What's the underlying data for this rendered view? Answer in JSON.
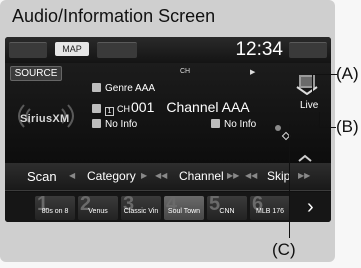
{
  "frame_title": "Audio/Information Screen",
  "header": {
    "map_label": "MAP",
    "clock": "12:34"
  },
  "info": {
    "source_label": "SOURCE",
    "brand": "SiriusXM",
    "ch_label": "CH",
    "genre": "Genre AAA",
    "preset_digit": "1",
    "ch_prefix": "CH",
    "channel_number": "001",
    "channel_name": "Channel AAA",
    "left_info": "No Info",
    "right_info": "No Info",
    "live_label": "Live"
  },
  "nav": {
    "scan": "Scan",
    "category": "Category",
    "channel": "Channel",
    "skip": "Skip"
  },
  "presets": [
    {
      "number": "1",
      "label": "80s on 8",
      "selected": false
    },
    {
      "number": "2",
      "label": "Venus",
      "selected": false
    },
    {
      "number": "3",
      "label": "Classic Vin",
      "selected": false
    },
    {
      "number": "4",
      "label": "Soul Town",
      "selected": true
    },
    {
      "number": "5",
      "label": "CNN",
      "selected": false
    },
    {
      "number": "6",
      "label": "MLB 176",
      "selected": false
    }
  ],
  "callouts": {
    "a": "(A)",
    "b": "(B)",
    "c": "(C)"
  }
}
